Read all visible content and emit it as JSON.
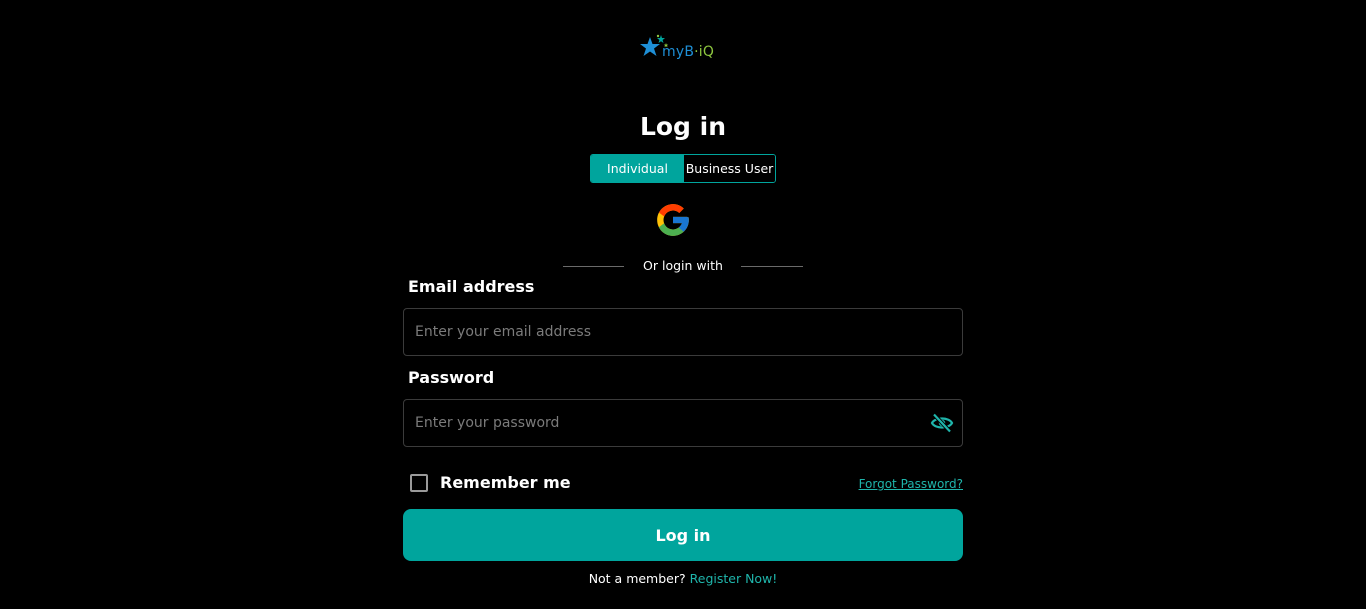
{
  "brand": {
    "logo_text_prefix": "my",
    "logo_text_b": "B",
    "logo_text_dot": "·",
    "logo_text_iq": "iQ"
  },
  "page": {
    "title": "Log in"
  },
  "account_type_toggle": {
    "options": [
      "Individual",
      "Business User"
    ],
    "selected": "Individual"
  },
  "divider": {
    "text": "Or login with"
  },
  "email": {
    "label": "Email address",
    "placeholder": "Enter your email address",
    "value": ""
  },
  "password": {
    "label": "Password",
    "placeholder": "Enter your password",
    "value": ""
  },
  "remember": {
    "label": "Remember me",
    "checked": false
  },
  "forgot": {
    "label": "Forgot Password?"
  },
  "submit": {
    "label": "Log in"
  },
  "register": {
    "prefix": "Not a member?",
    "link": "Register Now!"
  },
  "icons": {
    "logo": "star-logo-icon",
    "google": "google-icon",
    "password_visibility": "eye-off-icon"
  },
  "colors": {
    "background": "#000000",
    "accent": "#00a59d",
    "link": "#1fb5ab",
    "logo_blue": "#1e8fd6",
    "logo_green": "#8dc63f",
    "logo_teal": "#00a59d"
  }
}
